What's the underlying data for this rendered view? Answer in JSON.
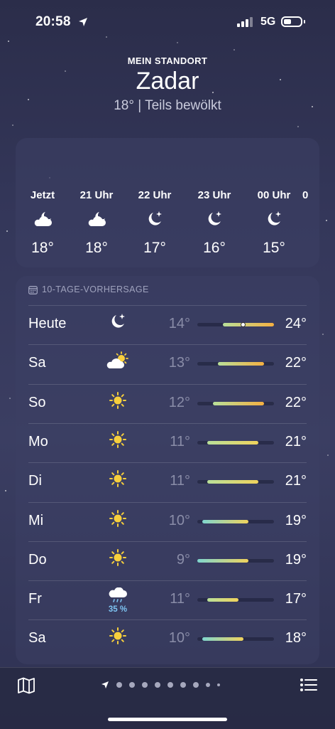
{
  "status": {
    "time": "20:58",
    "network": "5G",
    "icons": [
      "location-arrow-icon",
      "signal-icon",
      "battery-icon"
    ]
  },
  "header": {
    "label": "MEIN STANDORT",
    "city": "Zadar",
    "condition": "18°  |  Teils bewölkt"
  },
  "hourly": [
    {
      "label": "Jetzt",
      "icon": "cloud-moon",
      "temp": "18°"
    },
    {
      "label": "21 Uhr",
      "icon": "cloud-moon",
      "temp": "18°"
    },
    {
      "label": "22 Uhr",
      "icon": "moon-stars",
      "temp": "17°"
    },
    {
      "label": "23 Uhr",
      "icon": "moon-stars",
      "temp": "16°"
    },
    {
      "label": "00 Uhr",
      "icon": "moon-stars",
      "temp": "15°"
    },
    {
      "label": "0",
      "icon": "",
      "temp": ""
    }
  ],
  "daily": {
    "title": "10-TAGE-VORHERSAGE",
    "range_min": 9,
    "range_max": 24,
    "rows": [
      {
        "day": "Heute",
        "icon": "moon-stars",
        "lo": "14°",
        "hi": "24°",
        "lo_val": 14,
        "hi_val": 24,
        "now_val": 18,
        "precip": ""
      },
      {
        "day": "Sa",
        "icon": "sun-cloud",
        "lo": "13°",
        "hi": "22°",
        "lo_val": 13,
        "hi_val": 22,
        "precip": ""
      },
      {
        "day": "So",
        "icon": "sun",
        "lo": "12°",
        "hi": "22°",
        "lo_val": 12,
        "hi_val": 22,
        "precip": ""
      },
      {
        "day": "Mo",
        "icon": "sun",
        "lo": "11°",
        "hi": "21°",
        "lo_val": 11,
        "hi_val": 21,
        "precip": ""
      },
      {
        "day": "Di",
        "icon": "sun",
        "lo": "11°",
        "hi": "21°",
        "lo_val": 11,
        "hi_val": 21,
        "precip": ""
      },
      {
        "day": "Mi",
        "icon": "sun",
        "lo": "10°",
        "hi": "19°",
        "lo_val": 10,
        "hi_val": 19,
        "precip": ""
      },
      {
        "day": "Do",
        "icon": "sun",
        "lo": "9°",
        "hi": "19°",
        "lo_val": 9,
        "hi_val": 19,
        "precip": ""
      },
      {
        "day": "Fr",
        "icon": "cloud-rain",
        "lo": "11°",
        "hi": "17°",
        "lo_val": 11,
        "hi_val": 17,
        "precip": "35 %"
      },
      {
        "day": "Sa",
        "icon": "sun",
        "lo": "10°",
        "hi": "18°",
        "lo_val": 10,
        "hi_val": 18,
        "precip": ""
      }
    ]
  },
  "toolbar": {
    "map_icon": "map-icon",
    "list_icon": "list-icon",
    "pages": 9,
    "current_page": 0
  },
  "colors": {
    "cool": "#7fd6cf",
    "mild": "#b9e09a",
    "warm": "#f0d35c",
    "hot": "#f5b041"
  }
}
